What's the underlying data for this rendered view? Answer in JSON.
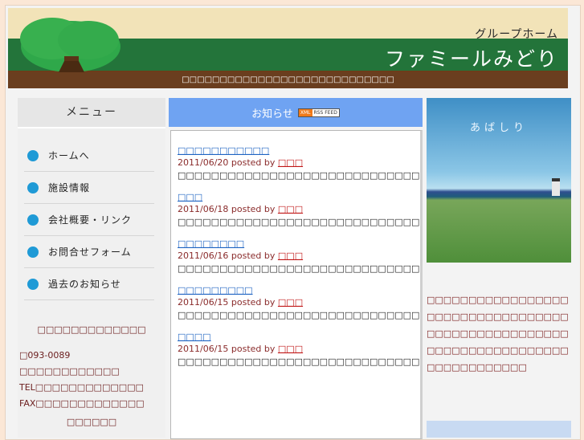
{
  "header": {
    "subtitle": "グループホーム",
    "title": "ファミールみどり",
    "tagline": "□□□□□□□□□□□□□□□□□□□□□□□□□□□□"
  },
  "menu": {
    "heading": "メニュー",
    "items": [
      {
        "label": "ホームへ"
      },
      {
        "label": "施設情報"
      },
      {
        "label": "会社概要・リンク"
      },
      {
        "label": "お問合せフォーム"
      },
      {
        "label": "過去のお知らせ"
      }
    ]
  },
  "address": {
    "title": "□□□□□□□□□□□□□",
    "postal": "□093-0089",
    "line1": "□□□□□□□□□□□□",
    "tel": "TEL□□□□□□□□□□□□□",
    "fax": "FAX□□□□□□□□□□□□□",
    "bottom": "□□□□□□"
  },
  "news": {
    "heading": "お知らせ",
    "rss_xml": "XML",
    "rss_feed": "RSS FEED",
    "items": [
      {
        "title": "□□□□□□□□□□□",
        "date": "2011/06/20",
        "posted": "posted by",
        "author": "□□□",
        "text": "□□□□□□□□□□□□□□□□□□□□□□□□□□□□□□□□□□□□□□□□□□..."
      },
      {
        "title": "□□□",
        "date": "2011/06/18",
        "posted": "posted by",
        "author": "□□□",
        "text": "□□□□□□□□□□□□□□□□□□□□□□□□□□□□□□□□□□□□□□□□□□..."
      },
      {
        "title": "□□□□□□□□",
        "date": "2011/06/16",
        "posted": "posted by",
        "author": "□□□",
        "text": "□□□□□□□□□□□□□□□□□□□□□□□□□□□□□□□□□□□□□□□□□□..."
      },
      {
        "title": "□□□□□□□□□",
        "date": "2011/06/15",
        "posted": "posted by",
        "author": "□□□",
        "text": "□□□□□□□□□□□□□□□□□□□□□□□□□□□□□□□□□□□"
      },
      {
        "title": "□□□□",
        "date": "2011/06/15",
        "posted": "posted by",
        "author": "□□□",
        "text": "□□□□□□□□□□□□□□□□□□□□□□□□□□□□□□□□□□□□□□□□□□..."
      }
    ]
  },
  "photo": {
    "caption": "あばしり",
    "description": "□□□□□□□□□□□□□□□□□□□□□□□□□□□□□□□□□□□□□□□□□□□□□□□□□□□□□□□□□□□□□□□□□□□□□□□□□□□□□□□□"
  },
  "colors": {
    "menu_dot": "#1f9ad6",
    "news_header": "#6fa3f2",
    "link": "#1d63c2",
    "accent_text": "#8a2b2b"
  }
}
